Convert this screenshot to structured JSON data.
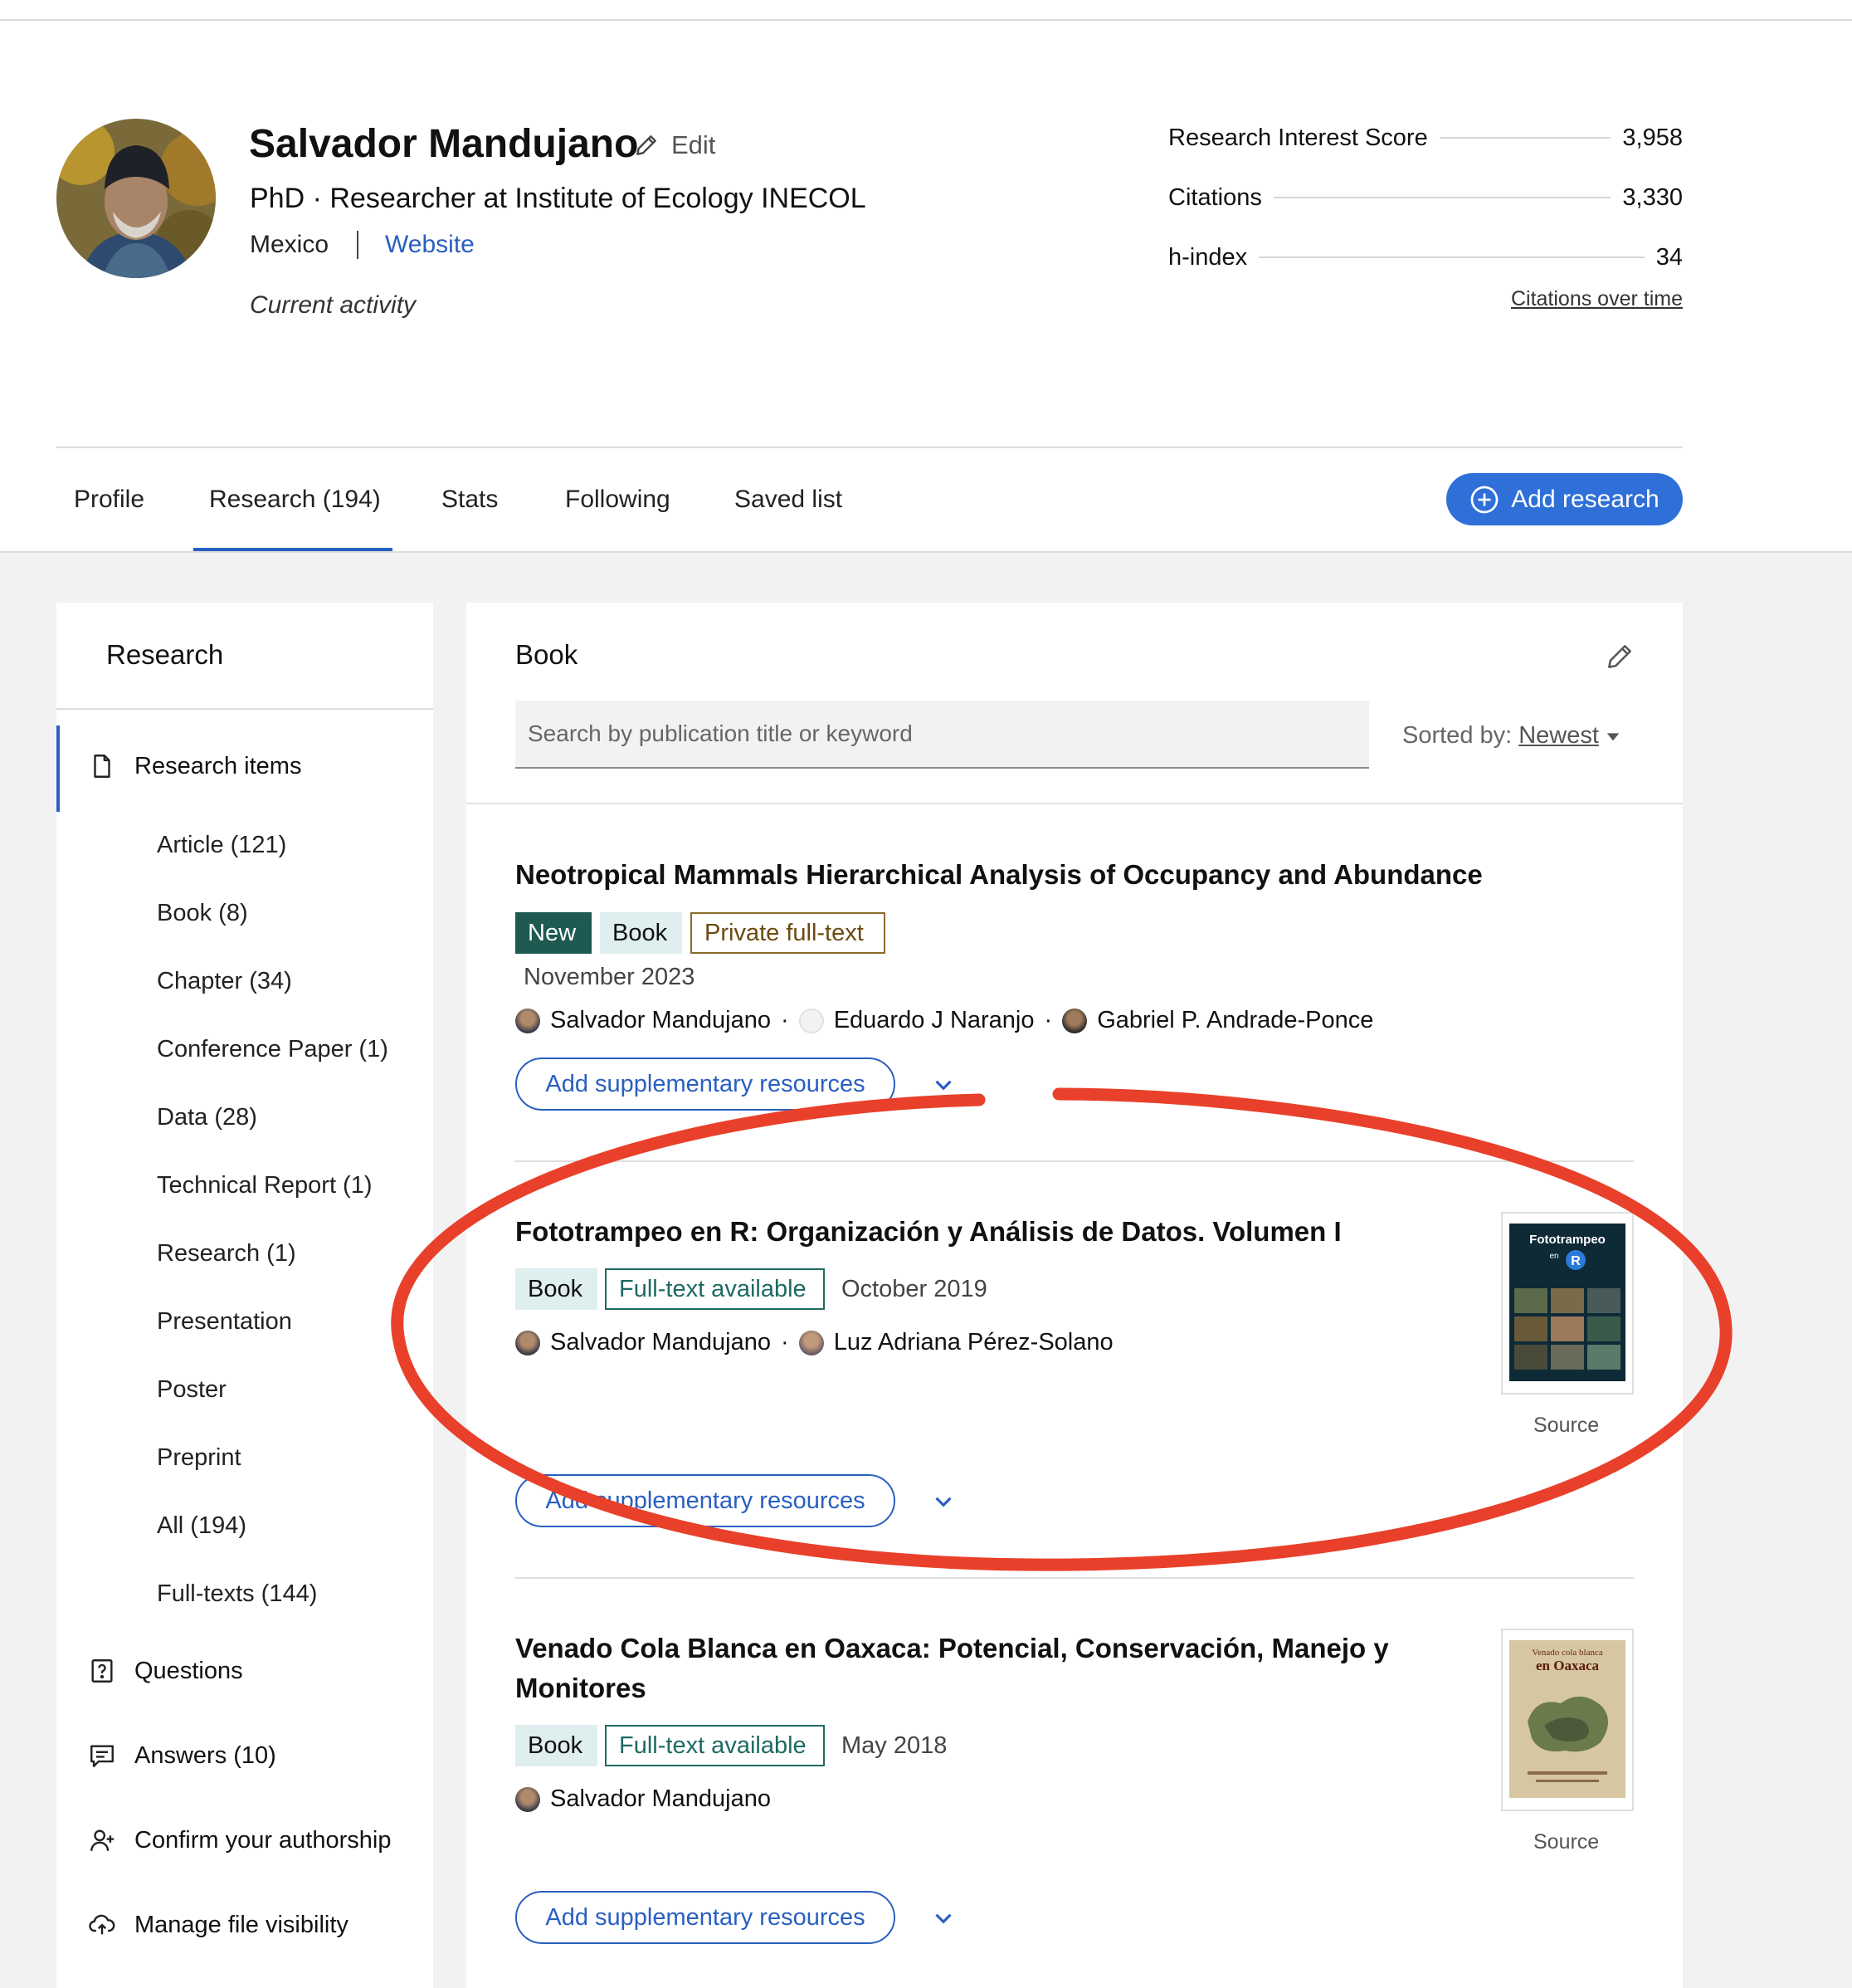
{
  "profile": {
    "name": "Salvador Mandujano",
    "edit_label": "Edit",
    "position": "PhD · Researcher at Institute of Ecology INECOL",
    "location": "Mexico",
    "website_label": "Website",
    "activity_label": "Current activity"
  },
  "stats": {
    "rows": [
      {
        "label": "Research Interest Score",
        "value": "3,958"
      },
      {
        "label": "Citations",
        "value": "3,330"
      },
      {
        "label": "h-index",
        "value": "34"
      }
    ],
    "citations_over_time": "Citations over time"
  },
  "tabs": {
    "items": [
      {
        "label": "Profile"
      },
      {
        "label": "Research (194)"
      },
      {
        "label": "Stats"
      },
      {
        "label": "Following"
      },
      {
        "label": "Saved list"
      }
    ],
    "active_index": 1,
    "add_research_label": "Add research",
    "accent_color": "#2a5fc1"
  },
  "sidebar": {
    "title": "Research",
    "research_items_label": "Research items",
    "sub_items": [
      "Article (121)",
      "Book (8)",
      "Chapter (34)",
      "Conference Paper (1)",
      "Data (28)",
      "Technical Report (1)",
      "Research (1)",
      "Presentation",
      "Poster",
      "Preprint",
      "All (194)",
      "Full-texts (144)"
    ],
    "actions": [
      {
        "label": "Questions",
        "icon": "question-icon"
      },
      {
        "label": "Answers (10)",
        "icon": "answers-icon"
      },
      {
        "label": "Confirm your authorship",
        "icon": "add-user-icon"
      },
      {
        "label": "Manage file visibility",
        "icon": "cloud-upload-icon"
      }
    ]
  },
  "main": {
    "title": "Book",
    "search_placeholder": "Search by publication title or keyword",
    "sorted_label": "Sorted by:",
    "sorted_value": "Newest",
    "publications": [
      {
        "title": "Neotropical Mammals Hierarchical Analysis of Occupancy and Abundance",
        "badges": [
          "New",
          "Book",
          "Private full-text"
        ],
        "date": "November 2023",
        "authors": [
          "Salvador Mandujano",
          "Eduardo J Naranjo",
          "Gabriel P. Andrade-Ponce"
        ],
        "supp_label": "Add supplementary resources"
      },
      {
        "title": "Fototrampeo en R: Organización y Análisis de Datos. Volumen I",
        "badges": [
          "Book",
          "Full-text available"
        ],
        "date": "October 2019",
        "authors": [
          "Salvador Mandujano",
          "Luz Adriana Pérez-Solano"
        ],
        "supp_label": "Add supplementary resources",
        "thumb_caption": "Source",
        "cover_text": [
          "Fototrampeo",
          "en",
          "R"
        ]
      },
      {
        "title": "Venado Cola Blanca en Oaxaca: Potencial, Conservación, Manejo y Monitores",
        "badges": [
          "Book",
          "Full-text available"
        ],
        "date": "May 2018",
        "authors": [
          "Salvador Mandujano"
        ],
        "supp_label": "Add supplementary resources",
        "thumb_caption": "Source",
        "cover_text": [
          "Venado cola blanca",
          "en Oaxaca"
        ]
      }
    ]
  },
  "annotation_color": "#e8402a"
}
